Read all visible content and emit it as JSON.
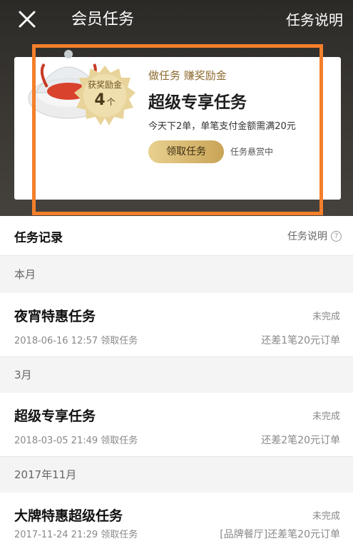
{
  "nav": {
    "title": "会员任务",
    "help": "任务说明"
  },
  "task_card": {
    "badge_title": "获奖励金",
    "badge_count": "4",
    "badge_unit": "个",
    "subtitle": "做任务 赚奖励金",
    "title": "超级专享任务",
    "description": "今天下2单，单笔支付金额需满20元",
    "claim_button": "领取任务",
    "bounty_status": "任务悬赏中"
  },
  "records": {
    "title": "任务记录",
    "help": "任务说明",
    "help_icon": "?",
    "groups": [
      {
        "month": "本月",
        "name": "夜宵特惠任务",
        "time": "2018-06-16 12:57 领取任务",
        "status": "未完成",
        "progress": "还差1笔20元订单"
      },
      {
        "month": "3月",
        "name": "超级专享任务",
        "time": "2018-03-05 21:49 领取任务",
        "status": "未完成",
        "progress": "还差2笔20元订单"
      },
      {
        "month": "2017年11月",
        "name": "大牌特惠超级任务",
        "time": "2017-11-24 21:29 领取任务",
        "status": "未完成",
        "progress": "[品牌餐厅]还差笔20元订单"
      }
    ]
  },
  "colors": {
    "highlight": "#f47f2b",
    "gold": "#c9a457",
    "header_dark": "#2c2a27"
  }
}
